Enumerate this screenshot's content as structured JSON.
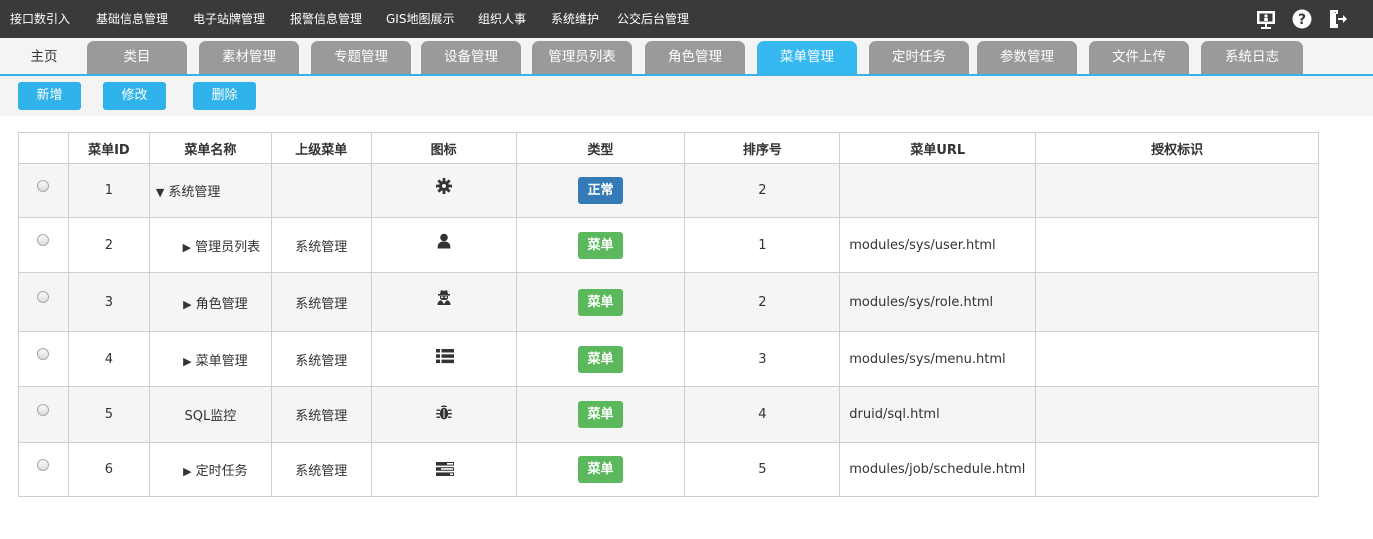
{
  "topnav": {
    "items": [
      "接口数引入",
      "基础信息管理",
      "电子站牌管理",
      "报警信息管理",
      "GIS地图展示",
      "组织人事",
      "系统维护",
      "公交后台管理"
    ],
    "icons": [
      "monitor-icon",
      "help-icon",
      "logout-icon"
    ]
  },
  "tabs": {
    "home": "主页",
    "items": [
      "类目",
      "素材管理",
      "专题管理",
      "设备管理",
      "管理员列表",
      "角色管理",
      "菜单管理",
      "定时任务",
      "参数管理",
      "文件上传",
      "系统日志"
    ],
    "active": "菜单管理"
  },
  "toolbar": {
    "add_label": "新增",
    "edit_label": "修改",
    "delete_label": "删除"
  },
  "table": {
    "headers": [
      "菜单ID",
      "菜单名称",
      "上级菜单",
      "图标",
      "类型",
      "排序号",
      "菜单URL",
      "授权标识"
    ],
    "rows": [
      {
        "id": "1",
        "arrow": "▼",
        "name": "系统管理",
        "parent": "",
        "icon": "gear-icon",
        "type": "正常",
        "type_color": "#337ab7",
        "order": "2",
        "url": "",
        "perm": ""
      },
      {
        "id": "2",
        "arrow": "▶",
        "name": "管理员列表",
        "parent": "系统管理",
        "icon": "user-icon",
        "type": "菜单",
        "type_color": "#5cb85c",
        "order": "1",
        "url": "modules/sys/user.html",
        "perm": ""
      },
      {
        "id": "3",
        "arrow": "▶",
        "name": "角色管理",
        "parent": "系统管理",
        "icon": "user-secret-icon",
        "type": "菜单",
        "type_color": "#5cb85c",
        "order": "2",
        "url": "modules/sys/role.html",
        "perm": ""
      },
      {
        "id": "4",
        "arrow": "▶",
        "name": "菜单管理",
        "parent": "系统管理",
        "icon": "list-icon",
        "type": "菜单",
        "type_color": "#5cb85c",
        "order": "3",
        "url": "modules/sys/menu.html",
        "perm": ""
      },
      {
        "id": "5",
        "arrow": "",
        "name": "SQL监控",
        "parent": "系统管理",
        "icon": "bug-icon",
        "type": "菜单",
        "type_color": "#5cb85c",
        "order": "4",
        "url": "druid/sql.html",
        "perm": ""
      },
      {
        "id": "6",
        "arrow": "▶",
        "name": "定时任务",
        "parent": "系统管理",
        "icon": "tasks-icon",
        "type": "菜单",
        "type_color": "#5cb85c",
        "order": "5",
        "url": "modules/job/schedule.html",
        "perm": ""
      }
    ]
  },
  "colors": {
    "topbar": "#3a3a3a",
    "accent": "#36b8f0",
    "tab_inactive": "#9a9a9a",
    "badge_normal": "#337ab7",
    "badge_menu": "#5cb85c"
  }
}
